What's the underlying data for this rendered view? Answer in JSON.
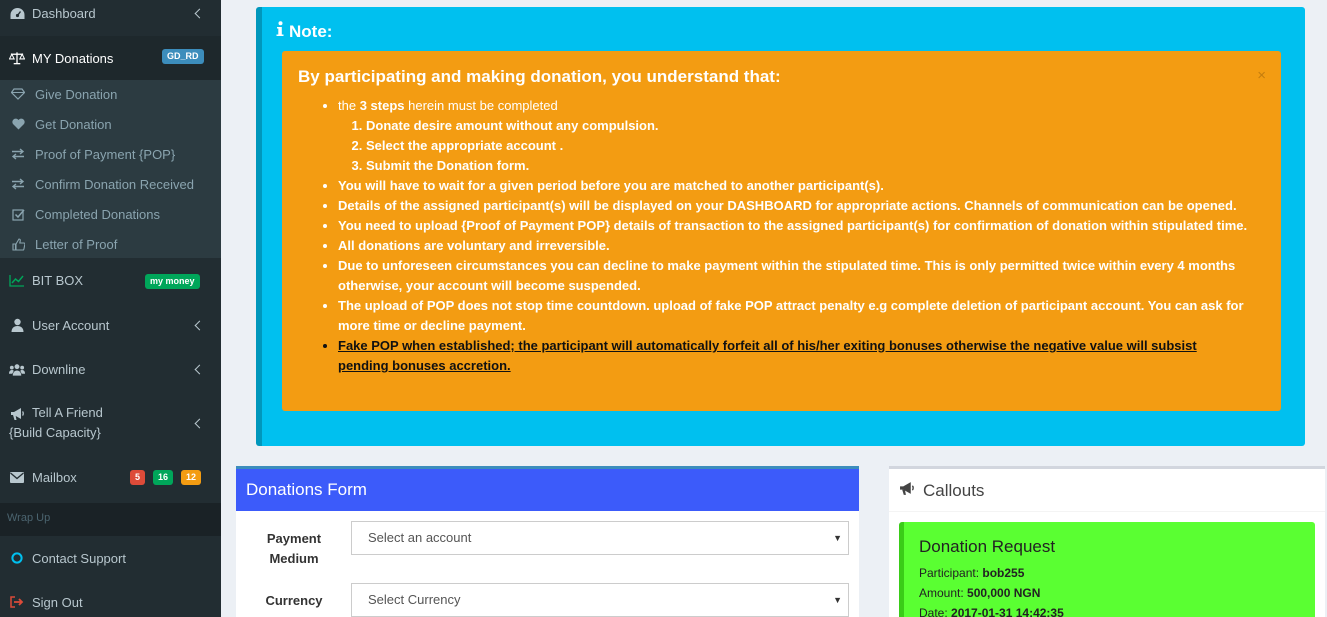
{
  "sidebar": {
    "dashboard": "Dashboard",
    "my_donations": "MY Donations",
    "my_donations_badge": "GD_RD",
    "sub": {
      "give": "Give Donation",
      "get": "Get Donation",
      "pop": "Proof of Payment {POP}",
      "confirm": "Confirm Donation Received",
      "completed": "Completed Donations",
      "letter": "Letter of Proof"
    },
    "bitbox": "BIT BOX",
    "bitbox_badge": "my money",
    "user_account": "User Account",
    "downline": "Downline",
    "tell_friend_1": "Tell A Friend",
    "tell_friend_2": "{Build Capacity}",
    "mailbox": "Mailbox",
    "mailbox_badges": [
      "5",
      "16",
      "12"
    ],
    "wrap_up": "Wrap Up",
    "contact": "Contact Support",
    "signout": "Sign Out"
  },
  "note": {
    "title": "Note:",
    "heading": "By participating and making donation, you understand that:",
    "close": "×",
    "item1_pre": "the ",
    "item1_bold": "3 steps",
    "item1_post": " herein must be completed",
    "steps": [
      "Donate desire amount without any compulsion.",
      "Select the appropriate account .",
      "Submit the Donation form."
    ],
    "items": [
      "You will have to wait for a given period before you are matched to another participant(s).",
      "Details of the assigned participant(s) will be displayed on your DASHBOARD for appropriate actions. Channels of communication can be opened.",
      "You need to upload {Proof of Payment POP} details of transaction to the assigned participant(s) for confirmation of donation within stipulated time.",
      "All donations are voluntary and irreversible.",
      "Due to unforeseen circumstances you can decline to make payment within the stipulated time. This is only permitted twice within every 4 months otherwise, your account will become suspended.",
      "The upload of POP does not stop time countdown. upload of fake POP attract penalty e.g complete deletion of participant account. You can ask for more time or decline payment."
    ],
    "last_item": "Fake POP when established; the participant will automatically forfeit all of his/her exiting bonuses otherwise the negative value will subsist pending bonuses accretion."
  },
  "form": {
    "title": "Donations Form",
    "payment_label": "Payment Medium",
    "payment_value": "Select an account",
    "currency_label": "Currency",
    "currency_value": "Select Currency"
  },
  "callouts": {
    "title": "Callouts",
    "req_title": "Donation Request",
    "participant_label": "Participant: ",
    "participant": "bob255",
    "amount_label": "Amount: ",
    "amount": "500,000 NGN",
    "date_label": "Date: ",
    "date": "2017-01-31 14:42:35"
  },
  "colors": {
    "sidebar": "#222d32",
    "note": "#00c0ef",
    "warning": "#f39c12",
    "form_header": "#3c5bfa",
    "callout_success": "#5aff32"
  }
}
